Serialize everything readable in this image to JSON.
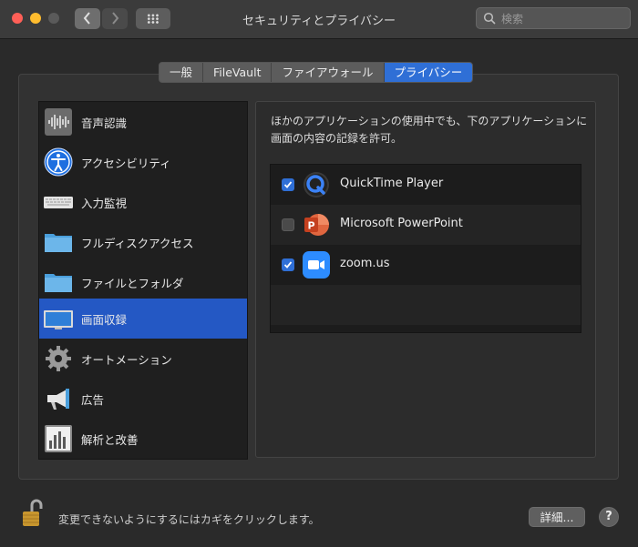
{
  "window": {
    "title": "セキュリティとプライバシー"
  },
  "toolbar": {
    "back_icon": "chevron-left-icon",
    "forward_icon": "chevron-right-icon",
    "grid_icon": "show-all-grid-icon",
    "search_placeholder": "検索"
  },
  "tabs": [
    {
      "label": "一般",
      "active": false
    },
    {
      "label": "FileVault",
      "active": false
    },
    {
      "label": "ファイアウォール",
      "active": false
    },
    {
      "label": "プライバシー",
      "active": true
    }
  ],
  "sidebar": {
    "items": [
      {
        "label": "音声認識",
        "icon": "waveform-icon",
        "selected": false
      },
      {
        "label": "アクセシビリティ",
        "icon": "accessibility-icon",
        "selected": false
      },
      {
        "label": "入力監視",
        "icon": "keyboard-icon",
        "selected": false
      },
      {
        "label": "フルディスクアクセス",
        "icon": "folder-icon",
        "selected": false
      },
      {
        "label": "ファイルとフォルダ",
        "icon": "folder-icon",
        "selected": false
      },
      {
        "label": "画面収録",
        "icon": "display-icon",
        "selected": true
      },
      {
        "label": "オートメーション",
        "icon": "gear-icon",
        "selected": false
      },
      {
        "label": "広告",
        "icon": "megaphone-icon",
        "selected": false
      },
      {
        "label": "解析と改善",
        "icon": "bar-chart-icon",
        "selected": false
      }
    ]
  },
  "main": {
    "description": "ほかのアプリケーションの使用中でも、下のアプリケーションに画面の内容の記録を許可。",
    "apps": [
      {
        "name": "QuickTime Player",
        "checked": true,
        "icon": "quicktime-icon"
      },
      {
        "name": "Microsoft PowerPoint",
        "checked": false,
        "icon": "powerpoint-icon"
      },
      {
        "name": "zoom.us",
        "checked": true,
        "icon": "zoom-icon"
      }
    ]
  },
  "footer": {
    "lock_text": "変更できないようにするにはカギをクリックします。",
    "advanced_label": "詳細...",
    "help_label": "?"
  },
  "colors": {
    "accent": "#2f6fd6",
    "selection": "#2458c4"
  }
}
